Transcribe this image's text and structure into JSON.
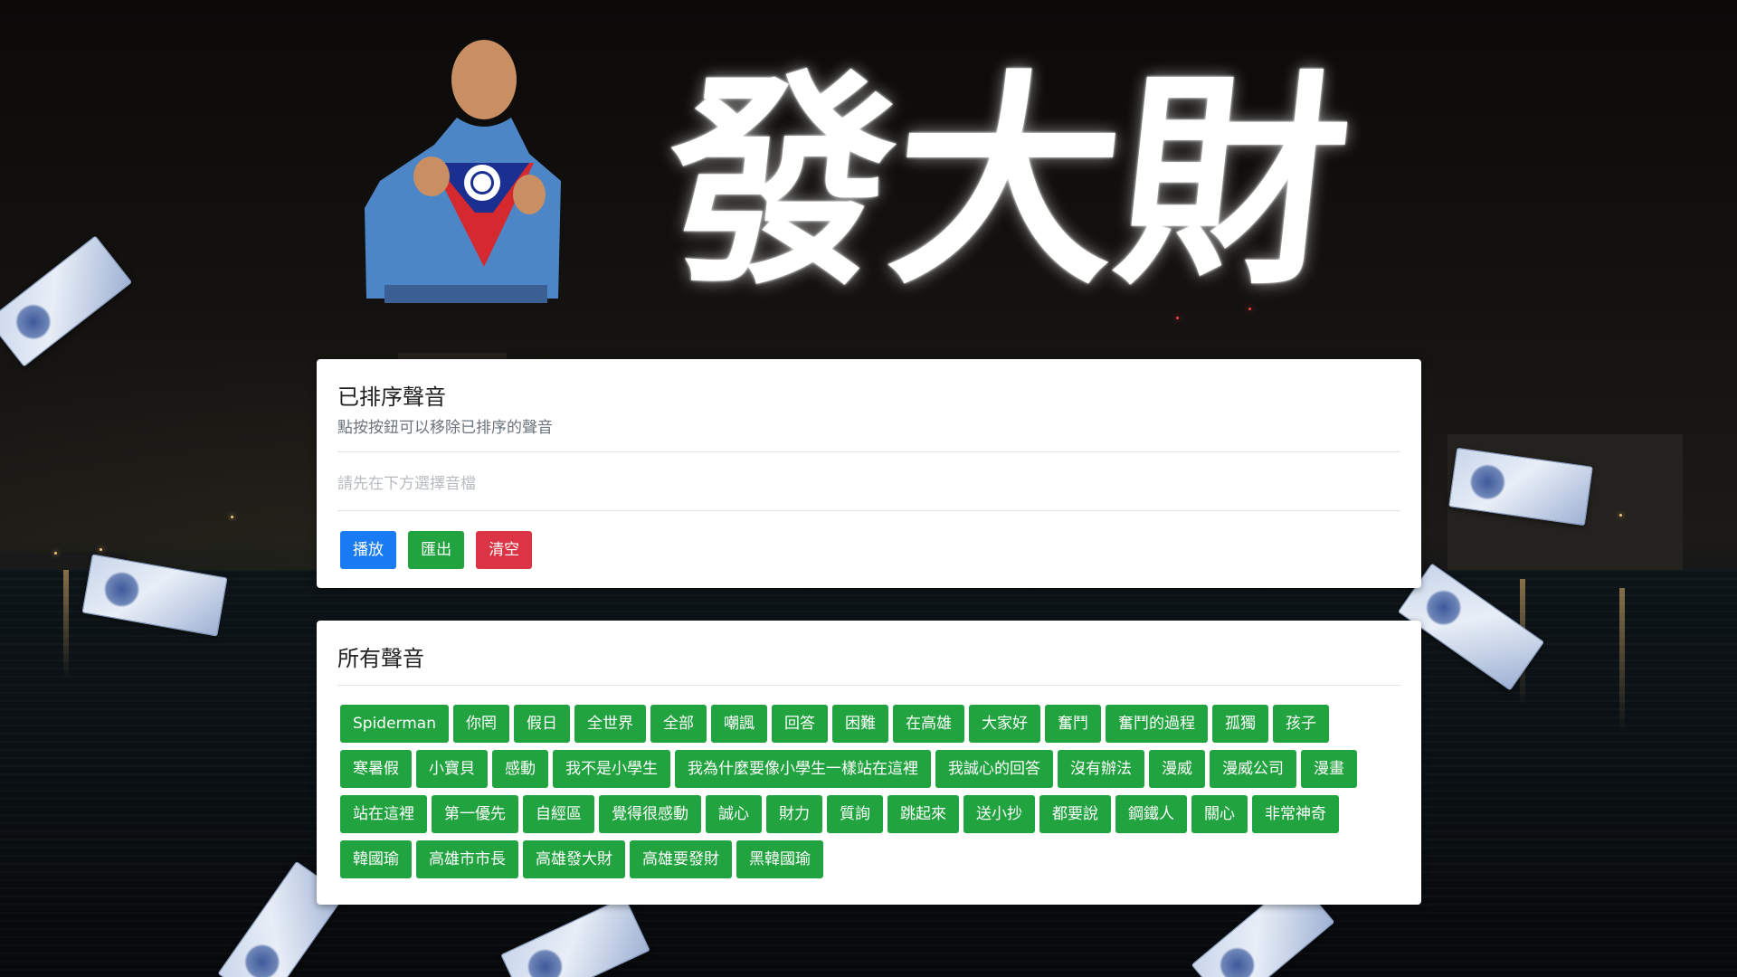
{
  "hero": {
    "title": "發大財",
    "figure_icon": "hero-figure-with-flag-icon"
  },
  "queue": {
    "title": "已排序聲音",
    "subtitle": "點按按鈕可以移除已排序的聲音",
    "empty_text": "請先在下方選擇音檔",
    "play_label": "播放",
    "export_label": "匯出",
    "clear_label": "清空"
  },
  "all_sounds": {
    "title": "所有聲音",
    "items": [
      "Spiderman",
      "你罔",
      "假日",
      "全世界",
      "全部",
      "嘲諷",
      "回答",
      "困難",
      "在高雄",
      "大家好",
      "奮鬥",
      "奮鬥的過程",
      "孤獨",
      "孩子",
      "寒暑假",
      "小寶貝",
      "感動",
      "我不是小學生",
      "我為什麼要像小學生一樣站在這裡",
      "我誠心的回答",
      "沒有辦法",
      "漫威",
      "漫威公司",
      "漫畫",
      "站在這裡",
      "第一優先",
      "自經區",
      "覺得很感動",
      "誠心",
      "財力",
      "質詢",
      "跳起來",
      "送小抄",
      "都要說",
      "鋼鐵人",
      "關心",
      "非常神奇",
      "韓國瑜",
      "高雄市市長",
      "高雄發大財",
      "高雄要發財",
      "黑韓國瑜"
    ]
  },
  "colors": {
    "primary": "#1a7cf5",
    "success": "#21a33f",
    "danger": "#db3545"
  }
}
